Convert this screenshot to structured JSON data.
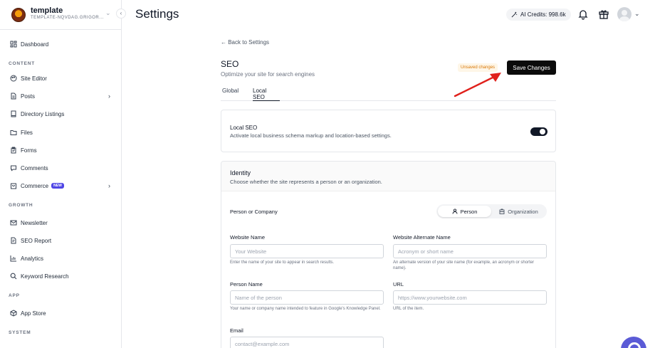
{
  "workspace": {
    "name": "template",
    "subtitle": "TEMPLATE-NQVDAG.GRIGOR..."
  },
  "header": {
    "title": "Settings",
    "credits": "AI Credits: 998.6k"
  },
  "sidebar": {
    "items": [
      {
        "label": "Dashboard",
        "icon": "dashboard-icon"
      },
      {
        "label": "Site Editor",
        "icon": "palette-icon"
      },
      {
        "label": "Posts",
        "icon": "document-icon"
      },
      {
        "label": "Directory Listings",
        "icon": "book-icon"
      },
      {
        "label": "Files",
        "icon": "folder-icon"
      },
      {
        "label": "Forms",
        "icon": "clipboard-icon"
      },
      {
        "label": "Comments",
        "icon": "comment-icon"
      },
      {
        "label": "Commerce",
        "icon": "cart-icon",
        "badge": "NEW"
      },
      {
        "label": "Newsletter",
        "icon": "mail-icon"
      },
      {
        "label": "SEO Report",
        "icon": "report-icon"
      },
      {
        "label": "Analytics",
        "icon": "chart-icon"
      },
      {
        "label": "Keyword Research",
        "icon": "search-icon"
      },
      {
        "label": "App Store",
        "icon": "package-icon"
      }
    ],
    "sections": [
      "CONTENT",
      "GROWTH",
      "APP",
      "SYSTEM"
    ]
  },
  "main": {
    "back_link": "← Back to Settings",
    "title": "SEO",
    "subtitle": "Optimize your site for search engines",
    "unsaved": "Unsaved changes",
    "save_label": "Save Changes",
    "tabs": [
      "Global",
      "Local SEO"
    ],
    "local_seo": {
      "title": "Local SEO",
      "desc": "Activate local business schema markup and location-based settings.",
      "enabled": true
    },
    "identity": {
      "title": "Identity",
      "desc": "Choose whether the site represents a person or an organization.",
      "type_label": "Person or Company",
      "options": [
        "Person",
        "Organization"
      ],
      "selected": "Person"
    },
    "fields": {
      "website_name": {
        "label": "Website Name",
        "placeholder": "Your Website",
        "help": "Enter the name of your site to appear in search results."
      },
      "website_alt": {
        "label": "Website Alternate Name",
        "placeholder": "Acronym or short name",
        "help": "An alternate version of your site name (for example, an acronym or shorter name)."
      },
      "person_name": {
        "label": "Person Name",
        "placeholder": "Name of the person",
        "help": "Your name or company name intended to feature in Google's Knowledge Panel."
      },
      "url": {
        "label": "URL",
        "placeholder": "https://www.yourwebsite.com",
        "help": "URL of the item."
      },
      "email": {
        "label": "Email",
        "placeholder": "contact@example.com"
      }
    }
  },
  "colors": {
    "accent": "#111827",
    "annotation_arrow": "#e0201b",
    "unsaved": "#d97706",
    "badge": "#4f46e5"
  }
}
